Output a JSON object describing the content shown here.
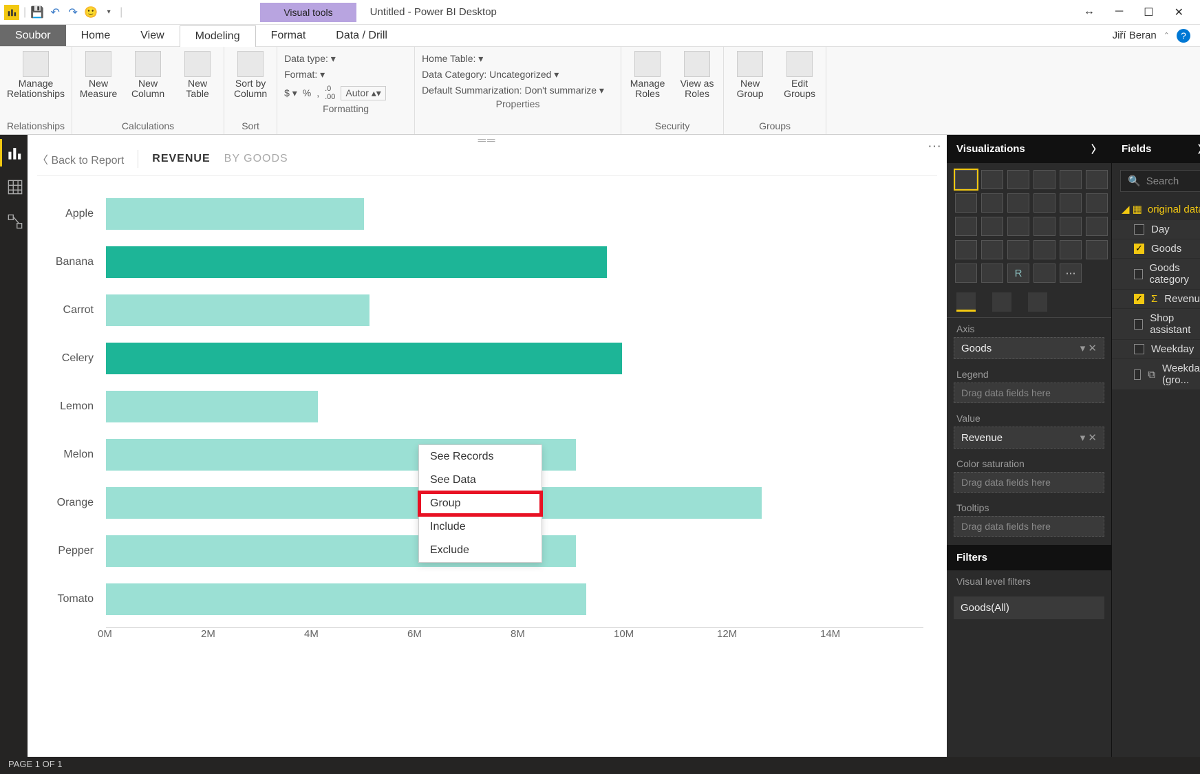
{
  "titlebar": {
    "visual_tools": "Visual tools",
    "title": "Untitled - Power BI Desktop"
  },
  "tabs": {
    "file": "Soubor",
    "home": "Home",
    "view": "View",
    "modeling": "Modeling",
    "format": "Format",
    "datadrill": "Data / Drill",
    "user": "Jiří Beran"
  },
  "ribbon": {
    "relationships": {
      "manage": "Manage\nRelationships",
      "group": "Relationships"
    },
    "calc": {
      "measure": "New\nMeasure",
      "column": "New\nColumn",
      "table": "New\nTable",
      "group": "Calculations"
    },
    "sort": {
      "sortby": "Sort by\nColumn",
      "group": "Sort"
    },
    "fmt": {
      "datatype": "Data type:",
      "format": "Format:",
      "autor": "Autor",
      "group": "Formatting"
    },
    "prop": {
      "home": "Home Table:",
      "cat": "Data Category: Uncategorized",
      "sum": "Default Summarization: Don't summarize",
      "group": "Properties"
    },
    "sec": {
      "manage": "Manage\nRoles",
      "viewas": "View as\nRoles",
      "group": "Security"
    },
    "grp": {
      "new": "New\nGroup",
      "edit": "Edit\nGroups",
      "group": "Groups"
    }
  },
  "drill": {
    "back": "Back to Report",
    "level1": "REVENUE",
    "level2": "BY GOODS"
  },
  "chart_data": {
    "type": "bar",
    "orientation": "horizontal",
    "categories": [
      "Apple",
      "Banana",
      "Carrot",
      "Celery",
      "Lemon",
      "Melon",
      "Orange",
      "Pepper",
      "Tomato"
    ],
    "values": [
      5.0,
      9.7,
      5.1,
      10.0,
      4.1,
      9.1,
      12.7,
      9.1,
      9.3
    ],
    "selected": [
      "Banana",
      "Celery"
    ],
    "xlabel": "",
    "ylabel": "",
    "xlim": [
      0,
      14
    ],
    "xticks": [
      "0M",
      "2M",
      "4M",
      "6M",
      "8M",
      "10M",
      "12M",
      "14M"
    ],
    "unit": "M"
  },
  "ctx": {
    "see_records": "See Records",
    "see_data": "See Data",
    "group": "Group",
    "include": "Include",
    "exclude": "Exclude"
  },
  "viz": {
    "title": "Visualizations",
    "axis": "Axis",
    "axis_field": "Goods",
    "legend": "Legend",
    "legend_ph": "Drag data fields here",
    "value": "Value",
    "value_field": "Revenue",
    "colorsat": "Color saturation",
    "colorsat_ph": "Drag data fields here",
    "tooltips": "Tooltips",
    "tooltips_ph": "Drag data fields here",
    "filters": "Filters",
    "vlf": "Visual level filters",
    "goodsall": "Goods(All)"
  },
  "fields": {
    "title": "Fields",
    "search": "Search",
    "table": "original data",
    "list": [
      {
        "name": "Day",
        "checked": false
      },
      {
        "name": "Goods",
        "checked": true
      },
      {
        "name": "Goods category",
        "checked": false
      },
      {
        "name": "Revenue",
        "checked": true,
        "sigma": true
      },
      {
        "name": "Shop assistant",
        "checked": false
      },
      {
        "name": "Weekday",
        "checked": false
      },
      {
        "name": "Weekday (gro...",
        "checked": false,
        "group": true
      }
    ]
  },
  "status": "PAGE 1 OF 1"
}
